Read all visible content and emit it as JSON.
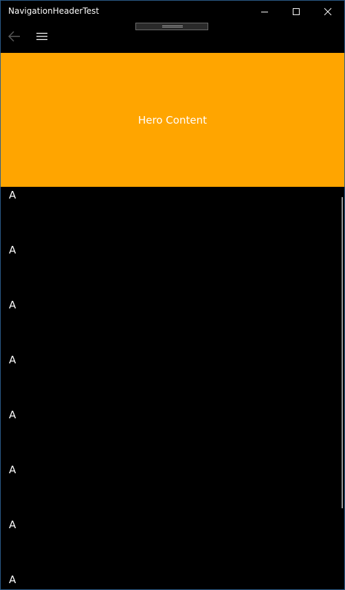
{
  "window": {
    "title": "NavigationHeaderTest"
  },
  "caption_buttons": {
    "minimize_icon": "minimize-icon",
    "maximize_icon": "maximize-icon",
    "close_icon": "close-icon"
  },
  "nav": {
    "back_icon": "back-arrow-icon",
    "menu_icon": "hamburger-menu-icon"
  },
  "hero": {
    "text": "Hero Content",
    "color": "#ffa500"
  },
  "list": {
    "items": [
      "A",
      "A",
      "A",
      "A",
      "A",
      "A",
      "A",
      "A"
    ]
  }
}
